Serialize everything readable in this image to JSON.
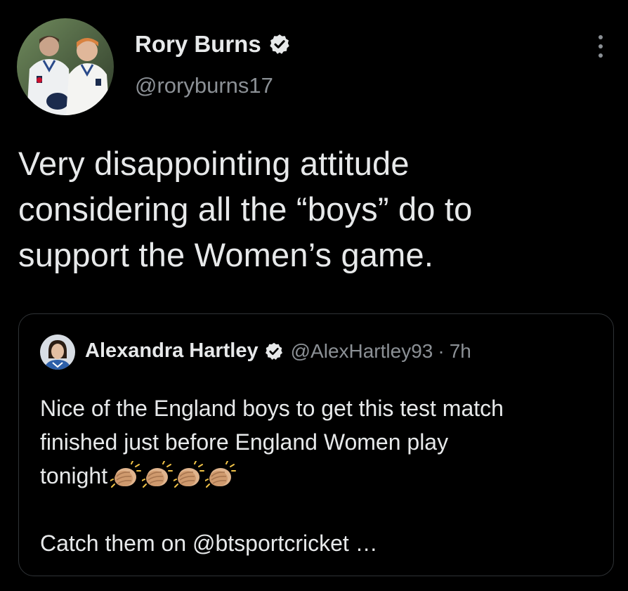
{
  "tweet": {
    "author": {
      "name": "Rory Burns",
      "handle": "@roryburns17",
      "verified": true,
      "avatar_icon": "profile-photo-two-cricketers"
    },
    "menu_icon": "more-vertical-icon",
    "text_lines": [
      "Very disappointing attitude",
      "considering all the “boys” do to",
      "support the Women’s game."
    ]
  },
  "quote": {
    "author": {
      "name": "Alexandra Hartley",
      "handle": "@AlexHartley93",
      "separator": "·",
      "time": "7h",
      "verified": true,
      "avatar_icon": "profile-photo-woman"
    },
    "text_lines": [
      "Nice of the England boys to get this test match",
      "finished just before England Women play",
      "tonight"
    ],
    "emoji": [
      "clapping-hands-icon",
      "clapping-hands-icon",
      "clapping-hands-icon",
      "clapping-hands-icon"
    ],
    "text_more": "Catch them on @btsportcricket …"
  },
  "colors": {
    "background": "#000000",
    "primary_text": "#e7e9ea",
    "secondary_text": "#8b9095",
    "border": "#2f3336",
    "verified_badge": "#e7e9ea"
  }
}
